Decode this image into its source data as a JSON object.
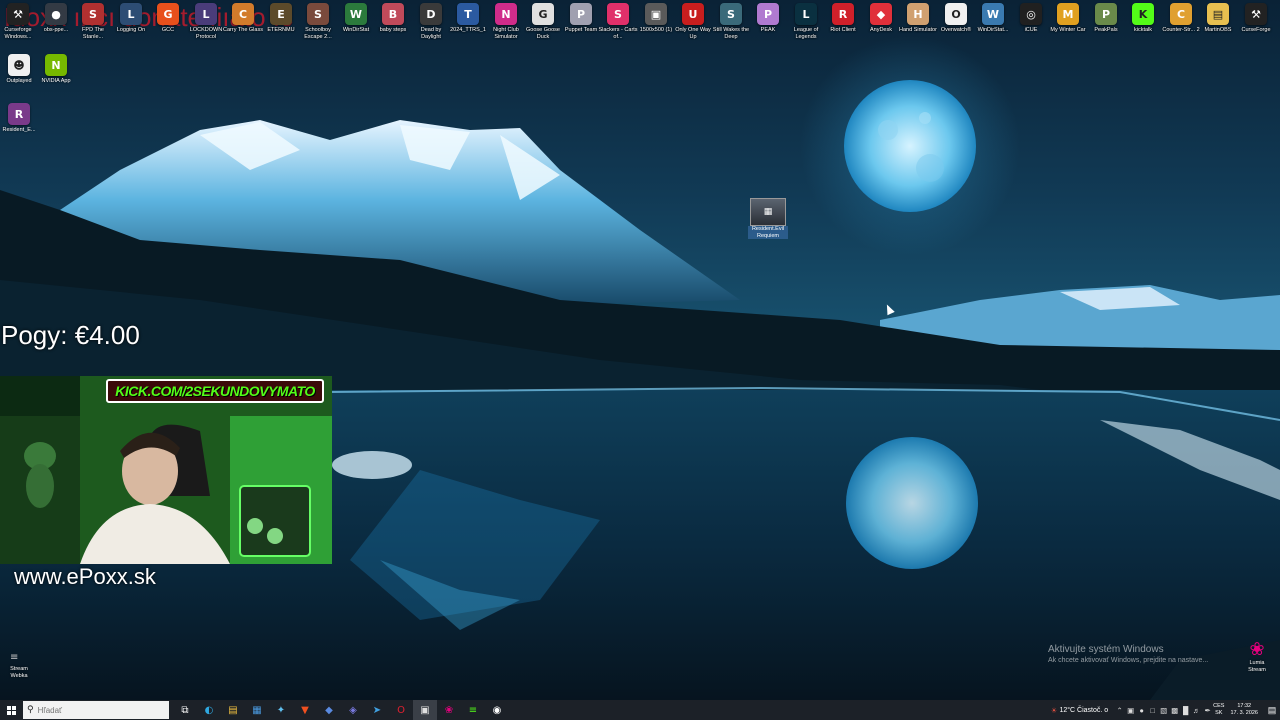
{
  "overlay": {
    "title_text": "Idoxx ıncı donate ıiıato  ıc",
    "pogy": "Pogy: €4.00",
    "kick_badge": "KICK.COM/2SEKUNDOVYMATO",
    "website": "www.ePoxx.sk"
  },
  "desktop_icons_top": [
    {
      "label": "Curseforge Windows...",
      "icon": "curseforge-icon",
      "color": "#222222",
      "glyph": "⚒"
    },
    {
      "label": "obs-ppe...",
      "icon": "obs-icon",
      "color": "#333a44",
      "glyph": "●"
    },
    {
      "label": "FPD The Stanle...",
      "icon": "game-icon",
      "color": "#b03030",
      "glyph": "S"
    },
    {
      "label": "Logging On",
      "icon": "game-icon",
      "color": "#2d4d74",
      "glyph": "L"
    },
    {
      "label": "GCC",
      "icon": "game-icon",
      "color": "#e8501c",
      "glyph": "G"
    },
    {
      "label": "LOCKDOWN Protocol",
      "icon": "game-icon",
      "color": "#4a3c7a",
      "glyph": "L"
    },
    {
      "label": "Carry The Glass",
      "icon": "game-icon",
      "color": "#d27b2b",
      "glyph": "C"
    },
    {
      "label": "ETERNMU",
      "icon": "game-icon",
      "color": "#5c4a2a",
      "glyph": "E"
    },
    {
      "label": "Schoolboy Escape 2...",
      "icon": "game-icon",
      "color": "#7a4a3c",
      "glyph": "S"
    },
    {
      "label": "WinDirStat",
      "icon": "windirstat-icon",
      "color": "#2b7a3c",
      "glyph": "W"
    },
    {
      "label": "baby steps",
      "icon": "game-icon",
      "color": "#c04a5a",
      "glyph": "B"
    },
    {
      "label": "Dead by Daylight",
      "icon": "game-icon",
      "color": "#3a3a3a",
      "glyph": "D"
    },
    {
      "label": "2024_TTRS_1",
      "icon": "file-icon",
      "color": "#2b5aa0",
      "glyph": "T"
    },
    {
      "label": "Night Club Simulator",
      "icon": "game-icon",
      "color": "#d02c8a",
      "glyph": "N"
    },
    {
      "label": "Goose Goose Duck",
      "icon": "game-icon",
      "color": "#e0e0e0",
      "glyph": "G"
    },
    {
      "label": "Puppet Team",
      "icon": "game-icon",
      "color": "#a0a0b0",
      "glyph": "P"
    },
    {
      "label": "Slackers - Carts of...",
      "icon": "game-icon",
      "color": "#e0306a",
      "glyph": "S"
    },
    {
      "label": "1500x500 (1)",
      "icon": "image-icon",
      "color": "#5a5a5a",
      "glyph": "▣"
    },
    {
      "label": "Only One Way Up",
      "icon": "game-icon",
      "color": "#c81e1e",
      "glyph": "U"
    },
    {
      "label": "Still Wakes the Deep",
      "icon": "game-icon",
      "color": "#3a6a7a",
      "glyph": "S"
    },
    {
      "label": "PEAK",
      "icon": "game-icon",
      "color": "#b07ad0",
      "glyph": "P"
    },
    {
      "label": "League of Legends",
      "icon": "game-icon",
      "color": "#0a3040",
      "glyph": "L"
    },
    {
      "label": "Riot Client",
      "icon": "riot-icon",
      "color": "#d0202a",
      "glyph": "R"
    },
    {
      "label": "AnyDesk",
      "icon": "anydesk-icon",
      "color": "#e0303a",
      "glyph": "◆"
    },
    {
      "label": "Hand Simulator",
      "icon": "game-icon",
      "color": "#d0a070",
      "glyph": "H"
    },
    {
      "label": "Overwatch®",
      "icon": "overwatch-icon",
      "color": "#f0f0f0",
      "glyph": "O"
    },
    {
      "label": "WinDirStat...",
      "icon": "windirstat-icon",
      "color": "#3a7ab0",
      "glyph": "W"
    },
    {
      "label": "iCUE",
      "icon": "icue-icon",
      "color": "#202020",
      "glyph": "◎"
    },
    {
      "label": "My Winter Car",
      "icon": "game-icon",
      "color": "#e0a020",
      "glyph": "M"
    },
    {
      "label": "PeakPals",
      "icon": "game-icon",
      "color": "#6a8a4a",
      "glyph": "P"
    },
    {
      "label": "kicktalk",
      "icon": "kick-icon",
      "color": "#53fc18",
      "glyph": "K"
    },
    {
      "label": "Counter-Str... 2",
      "icon": "game-icon",
      "color": "#e0a030",
      "glyph": "C"
    },
    {
      "label": "MartinOBS",
      "icon": "folder-icon",
      "color": "#e8c050",
      "glyph": "▤"
    },
    {
      "label": "CurseForge",
      "icon": "curseforge-icon",
      "color": "#222222",
      "glyph": "⚒"
    }
  ],
  "desktop_icons_left": [
    {
      "label": "Outplayed",
      "icon": "outplayed-icon",
      "color": "#f0f0f0",
      "glyph": "☻"
    },
    {
      "label": "NVIDIA App",
      "icon": "nvidia-icon",
      "color": "#76b900",
      "glyph": "N"
    },
    {
      "label": "Resident_E...",
      "icon": "winrar-icon",
      "color": "#7a3a8a",
      "glyph": "R"
    }
  ],
  "center_file": {
    "label": "Resident.Evil Requiem",
    "icon": "game-icon"
  },
  "bottom_left_icon": {
    "label": "Stream Webka",
    "icon": "stream-icon"
  },
  "lumia_icon": {
    "label": "Lumia Stream",
    "icon": "lumia-icon"
  },
  "activation": {
    "line1": "Aktivujte systém Windows",
    "line2": "Ak chcete aktivovať Windows, prejdite na nastave..."
  },
  "taskbar": {
    "search_placeholder": "Hľadať",
    "apps": [
      {
        "name": "task-view-icon",
        "glyph": "⧉",
        "color": "#ffffff"
      },
      {
        "name": "edge-icon",
        "glyph": "◐",
        "color": "#2fa8e0"
      },
      {
        "name": "explorer-icon",
        "glyph": "▤",
        "color": "#f0c040"
      },
      {
        "name": "store-icon",
        "glyph": "▦",
        "color": "#4a9ae0"
      },
      {
        "name": "app-icon",
        "glyph": "✦",
        "color": "#60c0f0"
      },
      {
        "name": "brave-icon",
        "glyph": "▼",
        "color": "#f05020"
      },
      {
        "name": "app-icon",
        "glyph": "◆",
        "color": "#5a8ae0"
      },
      {
        "name": "app-icon",
        "glyph": "◈",
        "color": "#7a7ae0"
      },
      {
        "name": "telegram-icon",
        "glyph": "➤",
        "color": "#40a0e0"
      },
      {
        "name": "opera-icon",
        "glyph": "O",
        "color": "#e02030"
      },
      {
        "name": "app-icon",
        "glyph": "▣",
        "color": "#e0e0e0"
      },
      {
        "name": "lumia-icon",
        "glyph": "❀",
        "color": "#e6007e"
      },
      {
        "name": "app-icon",
        "glyph": "≡",
        "color": "#53fc18"
      },
      {
        "name": "obs-icon",
        "glyph": "◉",
        "color": "#ffffff"
      }
    ],
    "weather": "12°C  Čiastoč. o",
    "lang_top": "CES",
    "lang_bottom": "SK",
    "time": "17:32",
    "date": "17. 3. 2026"
  }
}
